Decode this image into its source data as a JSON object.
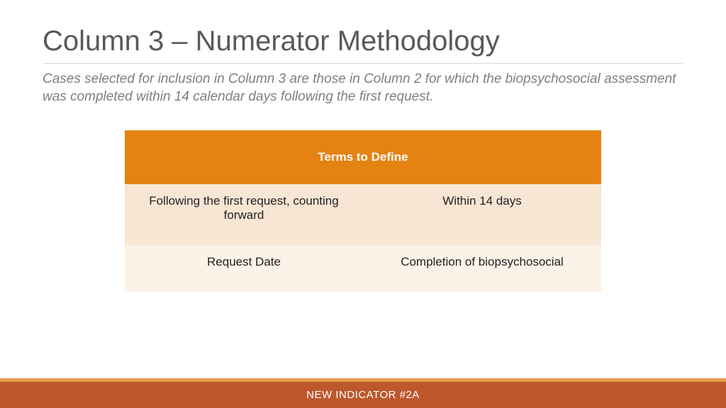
{
  "title": "Column 3 – Numerator Methodology",
  "subtitle": "Cases selected for inclusion in Column 3 are those in Column 2 for which the biopsychosocial assessment was completed within 14 calendar days following the first request.",
  "table": {
    "header": "Terms to Define",
    "rows": [
      {
        "left": "Following the first request, counting forward",
        "right": "Within 14 days"
      },
      {
        "left": "Request Date",
        "right": "Completion of biopsychosocial"
      }
    ]
  },
  "footer": "NEW INDICATOR #2A"
}
